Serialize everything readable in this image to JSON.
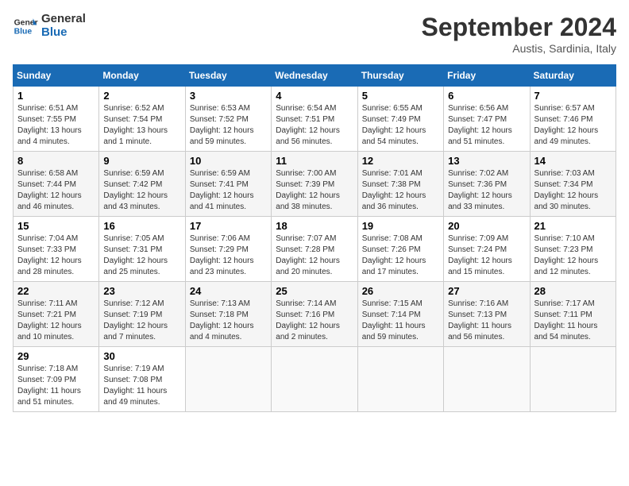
{
  "header": {
    "logo_line1": "General",
    "logo_line2": "Blue",
    "month_title": "September 2024",
    "subtitle": "Austis, Sardinia, Italy"
  },
  "weekdays": [
    "Sunday",
    "Monday",
    "Tuesday",
    "Wednesday",
    "Thursday",
    "Friday",
    "Saturday"
  ],
  "weeks": [
    [
      {
        "day": "1",
        "sunrise": "6:51 AM",
        "sunset": "7:55 PM",
        "daylight": "13 hours and 4 minutes."
      },
      {
        "day": "2",
        "sunrise": "6:52 AM",
        "sunset": "7:54 PM",
        "daylight": "13 hours and 1 minute."
      },
      {
        "day": "3",
        "sunrise": "6:53 AM",
        "sunset": "7:52 PM",
        "daylight": "12 hours and 59 minutes."
      },
      {
        "day": "4",
        "sunrise": "6:54 AM",
        "sunset": "7:51 PM",
        "daylight": "12 hours and 56 minutes."
      },
      {
        "day": "5",
        "sunrise": "6:55 AM",
        "sunset": "7:49 PM",
        "daylight": "12 hours and 54 minutes."
      },
      {
        "day": "6",
        "sunrise": "6:56 AM",
        "sunset": "7:47 PM",
        "daylight": "12 hours and 51 minutes."
      },
      {
        "day": "7",
        "sunrise": "6:57 AM",
        "sunset": "7:46 PM",
        "daylight": "12 hours and 49 minutes."
      }
    ],
    [
      {
        "day": "8",
        "sunrise": "6:58 AM",
        "sunset": "7:44 PM",
        "daylight": "12 hours and 46 minutes."
      },
      {
        "day": "9",
        "sunrise": "6:59 AM",
        "sunset": "7:42 PM",
        "daylight": "12 hours and 43 minutes."
      },
      {
        "day": "10",
        "sunrise": "6:59 AM",
        "sunset": "7:41 PM",
        "daylight": "12 hours and 41 minutes."
      },
      {
        "day": "11",
        "sunrise": "7:00 AM",
        "sunset": "7:39 PM",
        "daylight": "12 hours and 38 minutes."
      },
      {
        "day": "12",
        "sunrise": "7:01 AM",
        "sunset": "7:38 PM",
        "daylight": "12 hours and 36 minutes."
      },
      {
        "day": "13",
        "sunrise": "7:02 AM",
        "sunset": "7:36 PM",
        "daylight": "12 hours and 33 minutes."
      },
      {
        "day": "14",
        "sunrise": "7:03 AM",
        "sunset": "7:34 PM",
        "daylight": "12 hours and 30 minutes."
      }
    ],
    [
      {
        "day": "15",
        "sunrise": "7:04 AM",
        "sunset": "7:33 PM",
        "daylight": "12 hours and 28 minutes."
      },
      {
        "day": "16",
        "sunrise": "7:05 AM",
        "sunset": "7:31 PM",
        "daylight": "12 hours and 25 minutes."
      },
      {
        "day": "17",
        "sunrise": "7:06 AM",
        "sunset": "7:29 PM",
        "daylight": "12 hours and 23 minutes."
      },
      {
        "day": "18",
        "sunrise": "7:07 AM",
        "sunset": "7:28 PM",
        "daylight": "12 hours and 20 minutes."
      },
      {
        "day": "19",
        "sunrise": "7:08 AM",
        "sunset": "7:26 PM",
        "daylight": "12 hours and 17 minutes."
      },
      {
        "day": "20",
        "sunrise": "7:09 AM",
        "sunset": "7:24 PM",
        "daylight": "12 hours and 15 minutes."
      },
      {
        "day": "21",
        "sunrise": "7:10 AM",
        "sunset": "7:23 PM",
        "daylight": "12 hours and 12 minutes."
      }
    ],
    [
      {
        "day": "22",
        "sunrise": "7:11 AM",
        "sunset": "7:21 PM",
        "daylight": "12 hours and 10 minutes."
      },
      {
        "day": "23",
        "sunrise": "7:12 AM",
        "sunset": "7:19 PM",
        "daylight": "12 hours and 7 minutes."
      },
      {
        "day": "24",
        "sunrise": "7:13 AM",
        "sunset": "7:18 PM",
        "daylight": "12 hours and 4 minutes."
      },
      {
        "day": "25",
        "sunrise": "7:14 AM",
        "sunset": "7:16 PM",
        "daylight": "12 hours and 2 minutes."
      },
      {
        "day": "26",
        "sunrise": "7:15 AM",
        "sunset": "7:14 PM",
        "daylight": "11 hours and 59 minutes."
      },
      {
        "day": "27",
        "sunrise": "7:16 AM",
        "sunset": "7:13 PM",
        "daylight": "11 hours and 56 minutes."
      },
      {
        "day": "28",
        "sunrise": "7:17 AM",
        "sunset": "7:11 PM",
        "daylight": "11 hours and 54 minutes."
      }
    ],
    [
      {
        "day": "29",
        "sunrise": "7:18 AM",
        "sunset": "7:09 PM",
        "daylight": "11 hours and 51 minutes."
      },
      {
        "day": "30",
        "sunrise": "7:19 AM",
        "sunset": "7:08 PM",
        "daylight": "11 hours and 49 minutes."
      },
      null,
      null,
      null,
      null,
      null
    ]
  ]
}
